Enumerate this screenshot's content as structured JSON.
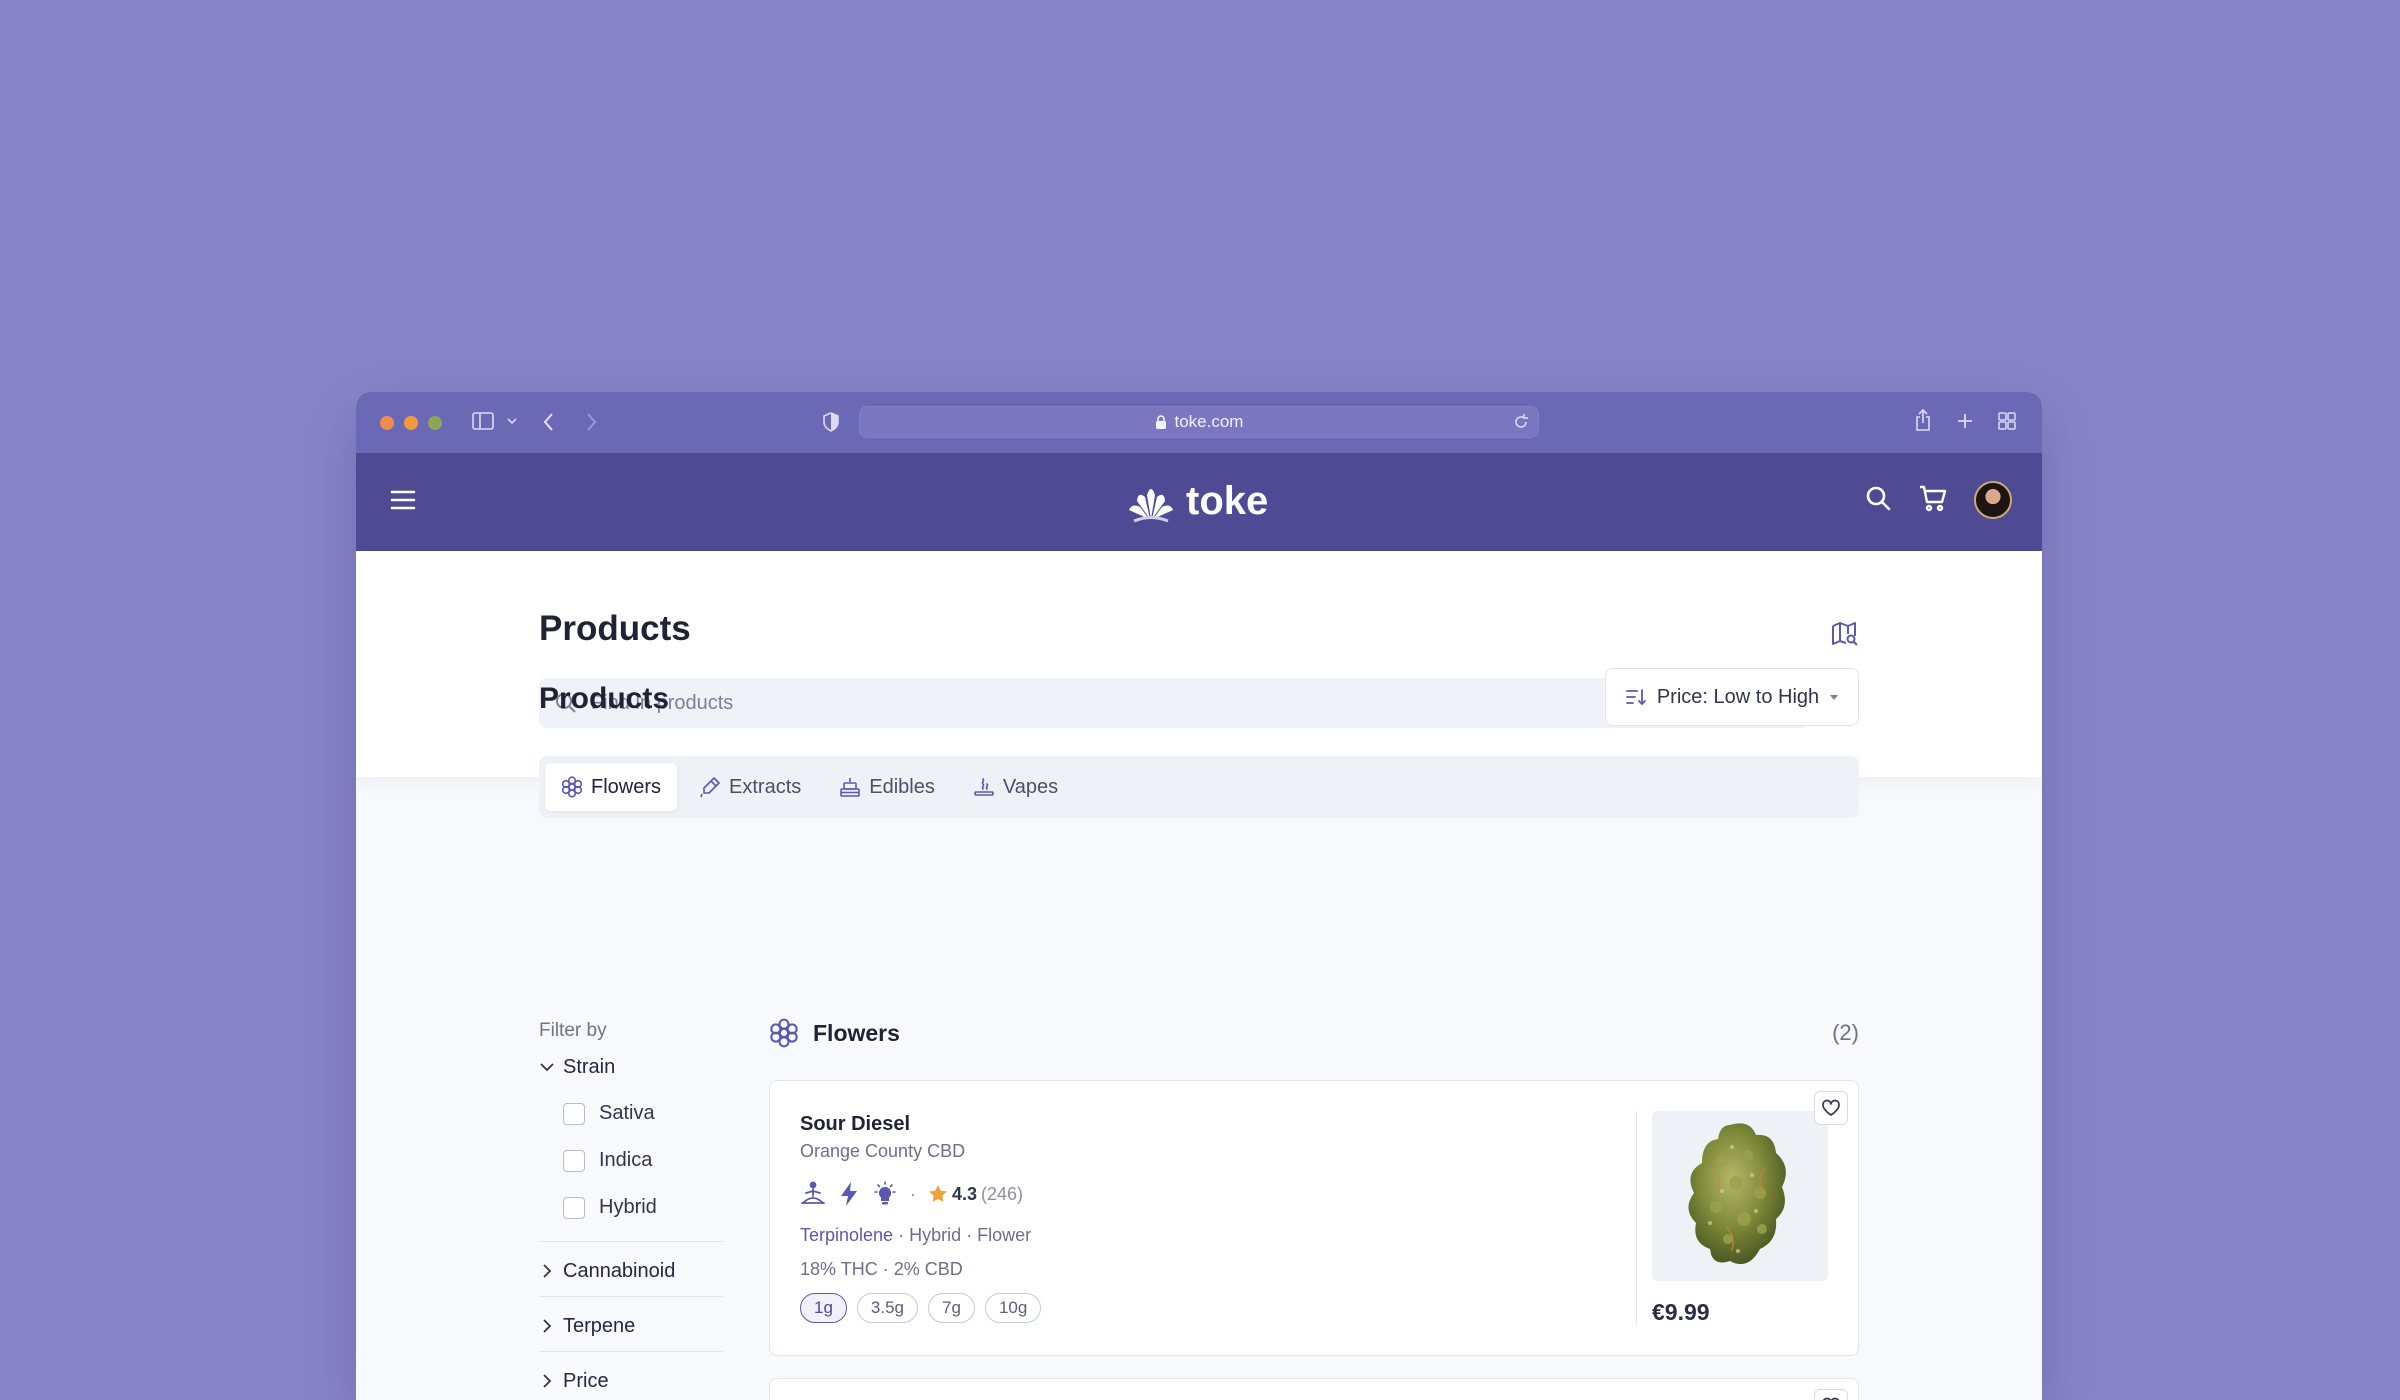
{
  "browser": {
    "url": "toke.com"
  },
  "brand": {
    "name": "toke"
  },
  "header": {
    "title": "Products",
    "search_placeholder": "Find in products"
  },
  "section": {
    "title": "Products",
    "sort_label": "Price: Low to High"
  },
  "tabs": [
    {
      "label": "Flowers",
      "icon": "flower-icon",
      "active": true
    },
    {
      "label": "Extracts",
      "icon": "dropper-icon",
      "active": false
    },
    {
      "label": "Edibles",
      "icon": "cake-icon",
      "active": false
    },
    {
      "label": "Vapes",
      "icon": "vape-icon",
      "active": false
    }
  ],
  "filters": {
    "title": "Filter by",
    "strain": {
      "label": "Strain",
      "options": [
        "Sativa",
        "Indica",
        "Hybrid"
      ]
    },
    "groups": [
      "Cannabinoid",
      "Terpene",
      "Price"
    ]
  },
  "list": {
    "title": "Flowers",
    "count": "(2)"
  },
  "products": [
    {
      "name": "Sour Diesel",
      "brand": "Orange County CBD",
      "effects": [
        "meditation-icon",
        "lightning-icon",
        "lightbulb-icon"
      ],
      "dot": "·",
      "rating": "4.3",
      "reviews": "(246)",
      "terpene": "Terpinolene",
      "type": "Hybrid",
      "category": "Flower",
      "sep": "·",
      "potency": "18% THC · 2% CBD",
      "sizes": [
        "1g",
        "3.5g",
        "7g",
        "10g"
      ],
      "selected_size": "1g",
      "price": "€9.99"
    }
  ],
  "colors": {
    "background": "#8886c8",
    "chrome": "#6b68b6",
    "nav": "#4e4a94",
    "accent": "#5b58b0",
    "star": "#f0a23a"
  }
}
